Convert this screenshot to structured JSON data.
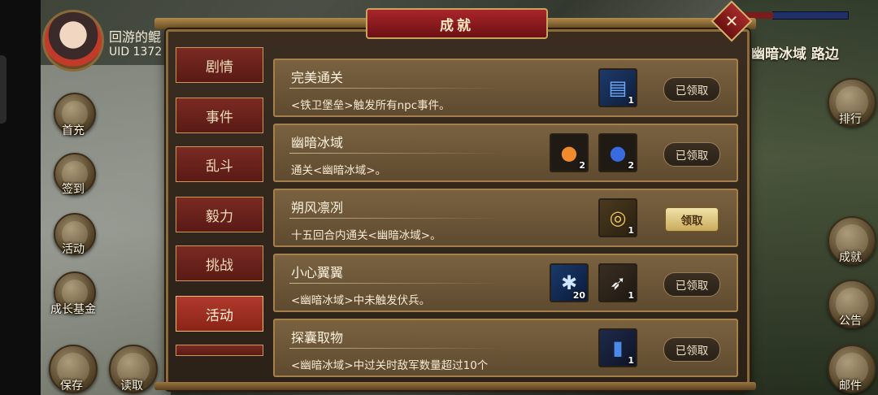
{
  "player": {
    "name": "回游的鲲",
    "uid": "UID  1372"
  },
  "location": "幽暗冰域 路边",
  "left_buttons": [
    {
      "label": "首充",
      "icon": "first-recharge-icon"
    },
    {
      "label": "签到",
      "icon": "sign-in-icon"
    },
    {
      "label": "活动",
      "icon": "activity-icon"
    },
    {
      "label": "成长基金",
      "icon": "growth-fund-icon"
    }
  ],
  "bottom_buttons": [
    {
      "label": "保存",
      "icon": "save-icon"
    },
    {
      "label": "读取",
      "icon": "load-icon"
    }
  ],
  "right_buttons": [
    {
      "label": "排行",
      "icon": "ranking-icon"
    },
    {
      "label": "成就",
      "icon": "achievement-icon"
    },
    {
      "label": "公告",
      "icon": "notice-icon"
    },
    {
      "label": "邮件",
      "icon": "mail-icon"
    }
  ],
  "dialog": {
    "title": "成就",
    "close_glyph": "✕",
    "tabs": [
      {
        "label": "剧情",
        "active": false
      },
      {
        "label": "事件",
        "active": false
      },
      {
        "label": "乱斗",
        "active": false
      },
      {
        "label": "毅力",
        "active": false
      },
      {
        "label": "挑战",
        "active": false
      },
      {
        "label": "活动",
        "active": true
      }
    ],
    "achievements": [
      {
        "name": "完美通关",
        "desc": "<铁卫堡垒>触发所有npc事件。",
        "rewards": [
          {
            "icon": "blue-book-icon",
            "count": "1"
          }
        ],
        "status": "已领取",
        "claimable": false
      },
      {
        "name": "幽暗冰域",
        "desc": "通关<幽暗冰域>。",
        "rewards": [
          {
            "icon": "orange-fruit-icon",
            "count": "2"
          },
          {
            "icon": "blue-fruit-icon",
            "count": "2"
          }
        ],
        "status": "已领取",
        "claimable": false
      },
      {
        "name": "朔风凛冽",
        "desc": "十五回合内通关<幽暗冰域>。",
        "rewards": [
          {
            "icon": "magnifier-relic-icon",
            "count": "1"
          }
        ],
        "status": "领取",
        "claimable": true
      },
      {
        "name": "小心翼翼",
        "desc": "<幽暗冰域>中未触发伏兵。",
        "rewards": [
          {
            "icon": "ice-crystal-icon",
            "count": "20"
          },
          {
            "icon": "white-feather-icon",
            "count": "1"
          }
        ],
        "status": "已领取",
        "claimable": false
      },
      {
        "name": "探囊取物",
        "desc": "<幽暗冰域>中过关时敌军数量超过10个",
        "rewards": [
          {
            "icon": "blue-scroll-icon",
            "count": "1"
          }
        ],
        "status": "已领取",
        "claimable": false
      }
    ]
  }
}
